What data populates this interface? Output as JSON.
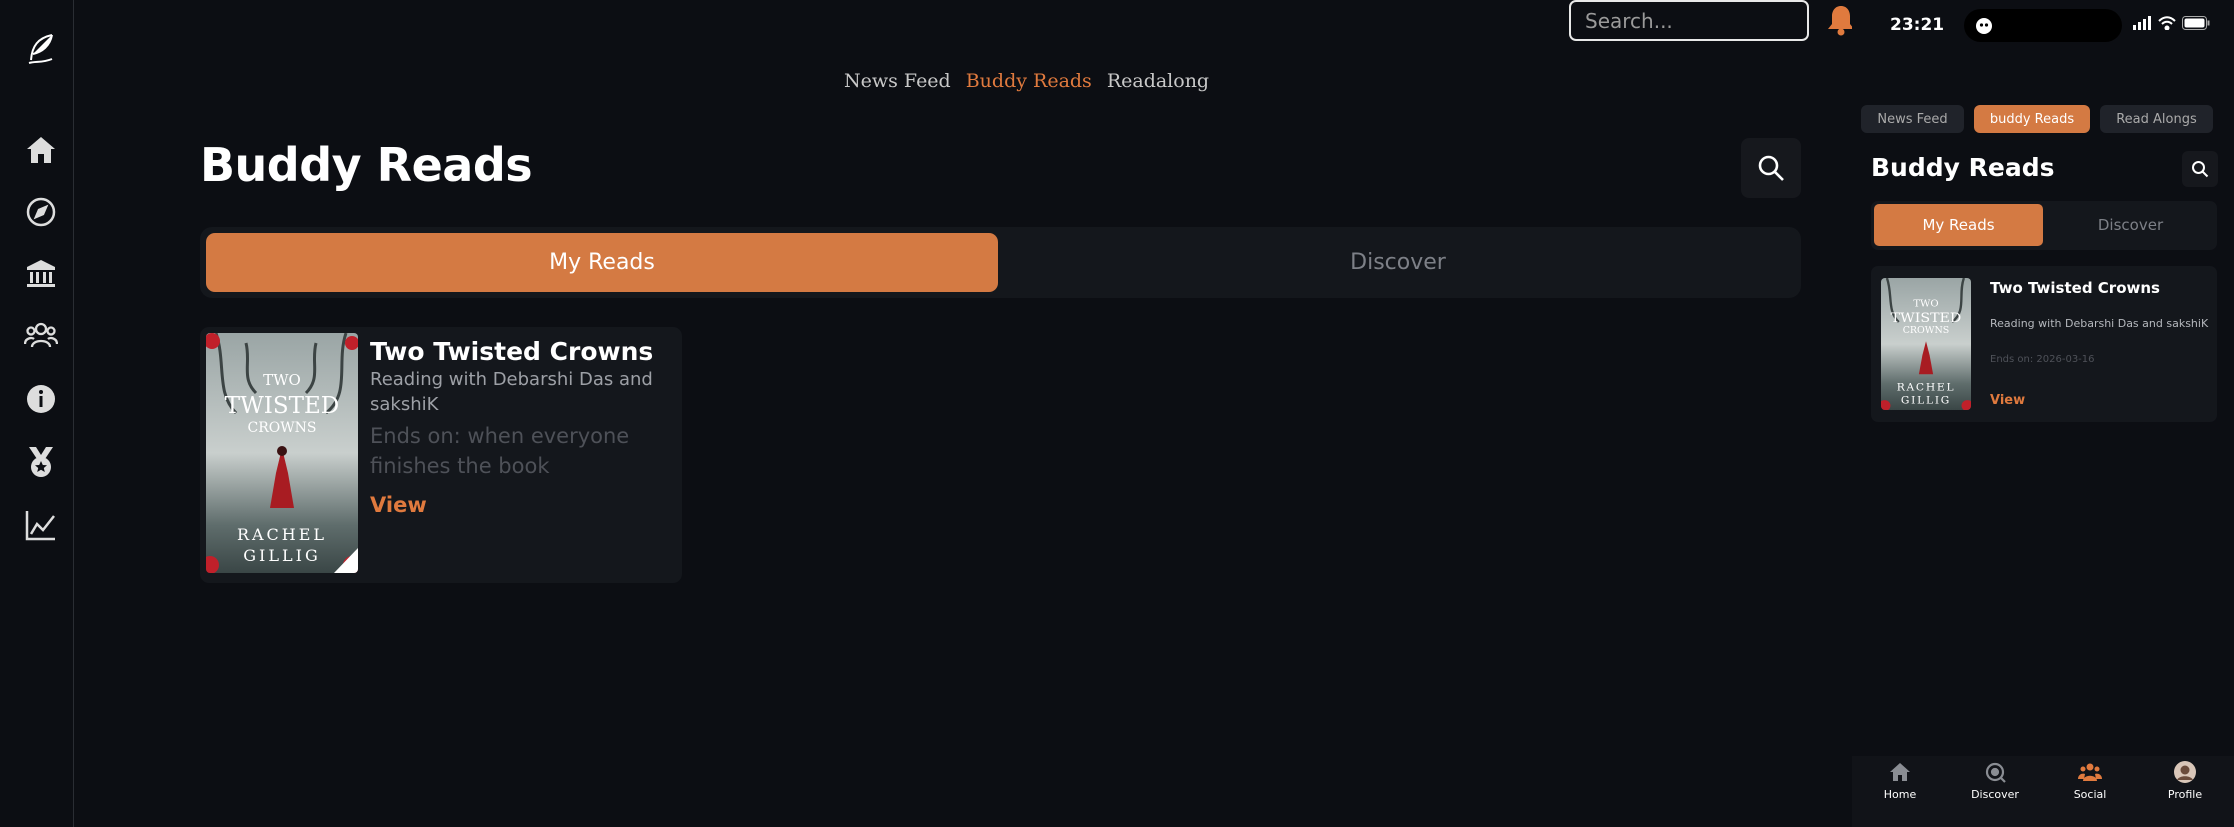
{
  "search": {
    "placeholder": "Search..."
  },
  "top_tabs": [
    "News Feed",
    "Buddy Reads",
    "Readalong"
  ],
  "main": {
    "title": "Buddy Reads",
    "segments": {
      "my_reads": "My Reads",
      "discover": "Discover"
    },
    "card": {
      "title": "Two Twisted Crowns",
      "subtitle": "Reading with Debarshi Das and sakshiK",
      "ends": "Ends on: when everyone finishes the book",
      "view": "View",
      "cover": {
        "line1": "TWO",
        "line2": "TWISTED",
        "line3": "CROWNS",
        "author1": "RACHEL",
        "author2": "GILLIG"
      }
    }
  },
  "phone": {
    "time": "23:21",
    "tabs": [
      "News Feed",
      "buddy Reads",
      "Read Alongs"
    ],
    "title": "Buddy Reads",
    "segments": {
      "my_reads": "My Reads",
      "discover": "Discover"
    },
    "card": {
      "title": "Two Twisted Crowns",
      "subtitle": "Reading with Debarshi Das and sakshiK",
      "ends": "Ends on: 2026-03-16",
      "view": "View"
    },
    "nav": [
      "Home",
      "Discover",
      "Social",
      "Profile"
    ]
  },
  "colors": {
    "accent": "#d47a43",
    "background": "#0c0e13",
    "card": "#14171c"
  }
}
